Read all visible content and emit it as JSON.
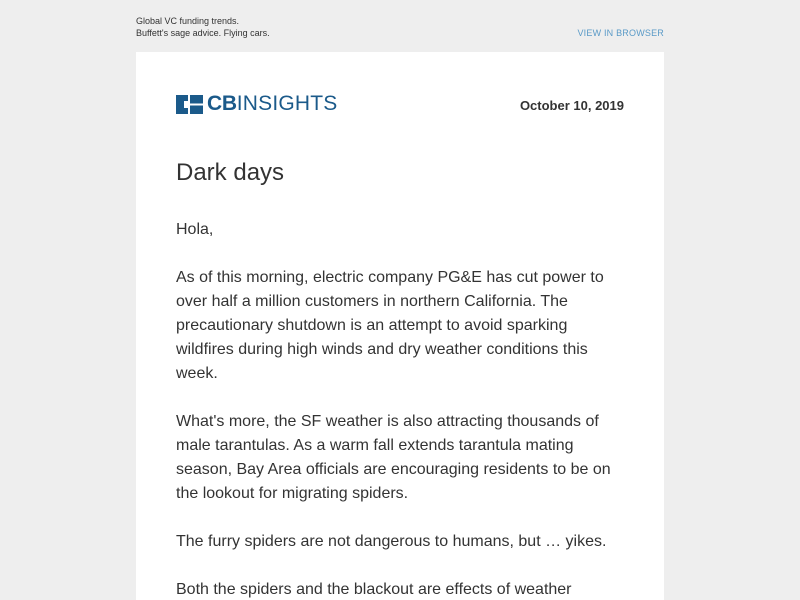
{
  "preheader": {
    "line1": "Global VC funding trends.",
    "line2": "Buffett's sage advice. Flying cars.",
    "view_in_browser": "VIEW IN BROWSER"
  },
  "header": {
    "logo_bold": "CB",
    "logo_light": "INSIGHTS",
    "date": "October 10, 2019"
  },
  "article": {
    "headline": "Dark days",
    "greeting": "Hola,",
    "paragraphs": [
      "As of this morning, electric company PG&E has cut power to over half a million customers in northern California. The precautionary shutdown is an attempt to avoid sparking wildfires during high winds and dry weather conditions this week.",
      "What's more, the SF weather is also attracting thousands of male tarantulas. As a warm fall extends tarantula mating season, Bay Area officials are encouraging residents to be on the lookout for migrating spiders.",
      "The furry spiders are not dangerous to humans, but … yikes.",
      "Both the spiders and the blackout are effects of weather"
    ]
  },
  "colors": {
    "background": "#eeeeee",
    "card": "#ffffff",
    "brand": "#1b5a8a",
    "link": "#5a9ac7",
    "text": "#333333"
  },
  "icons": {
    "logo": "cb-insights-logo-icon"
  }
}
